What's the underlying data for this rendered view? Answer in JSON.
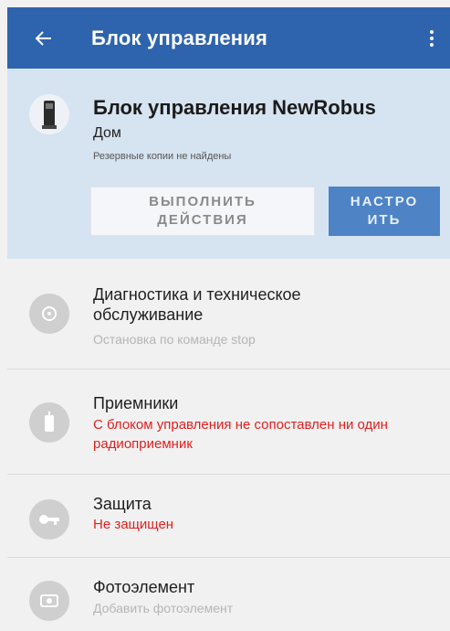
{
  "appbar": {
    "title": "Блок управления",
    "back_icon": "arrow-left-icon",
    "menu_icon": "more-vert-icon",
    "color": "#2e64ad"
  },
  "device": {
    "name": "Блок управления NewRobus",
    "location": "Дом",
    "backup_status": "Резервные копии не найдены",
    "icon": "control-unit-icon"
  },
  "buttons": {
    "actions_label": "ВЫПОЛНИТЬ ДЕЙСТВИЯ",
    "settings_label": "НАСТРОИТЬ"
  },
  "items": [
    {
      "title": "Диагностика и техническое обслуживание",
      "subtitle": "Остановка по команде stop",
      "subtitle_color": "gray",
      "icon": "diagnostics-icon"
    },
    {
      "title": "Приемники",
      "subtitle": "С блоком управления не сопоставлен ни один радиоприемник",
      "subtitle_color": "red",
      "icon": "receiver-icon"
    },
    {
      "title": "Защита",
      "subtitle": "Не защищен",
      "subtitle_color": "red",
      "icon": "key-icon"
    },
    {
      "title": "Фотоэлемент",
      "subtitle": "Добавить фотоэлемент",
      "subtitle_color": "gray",
      "icon": "photocell-icon"
    }
  ]
}
